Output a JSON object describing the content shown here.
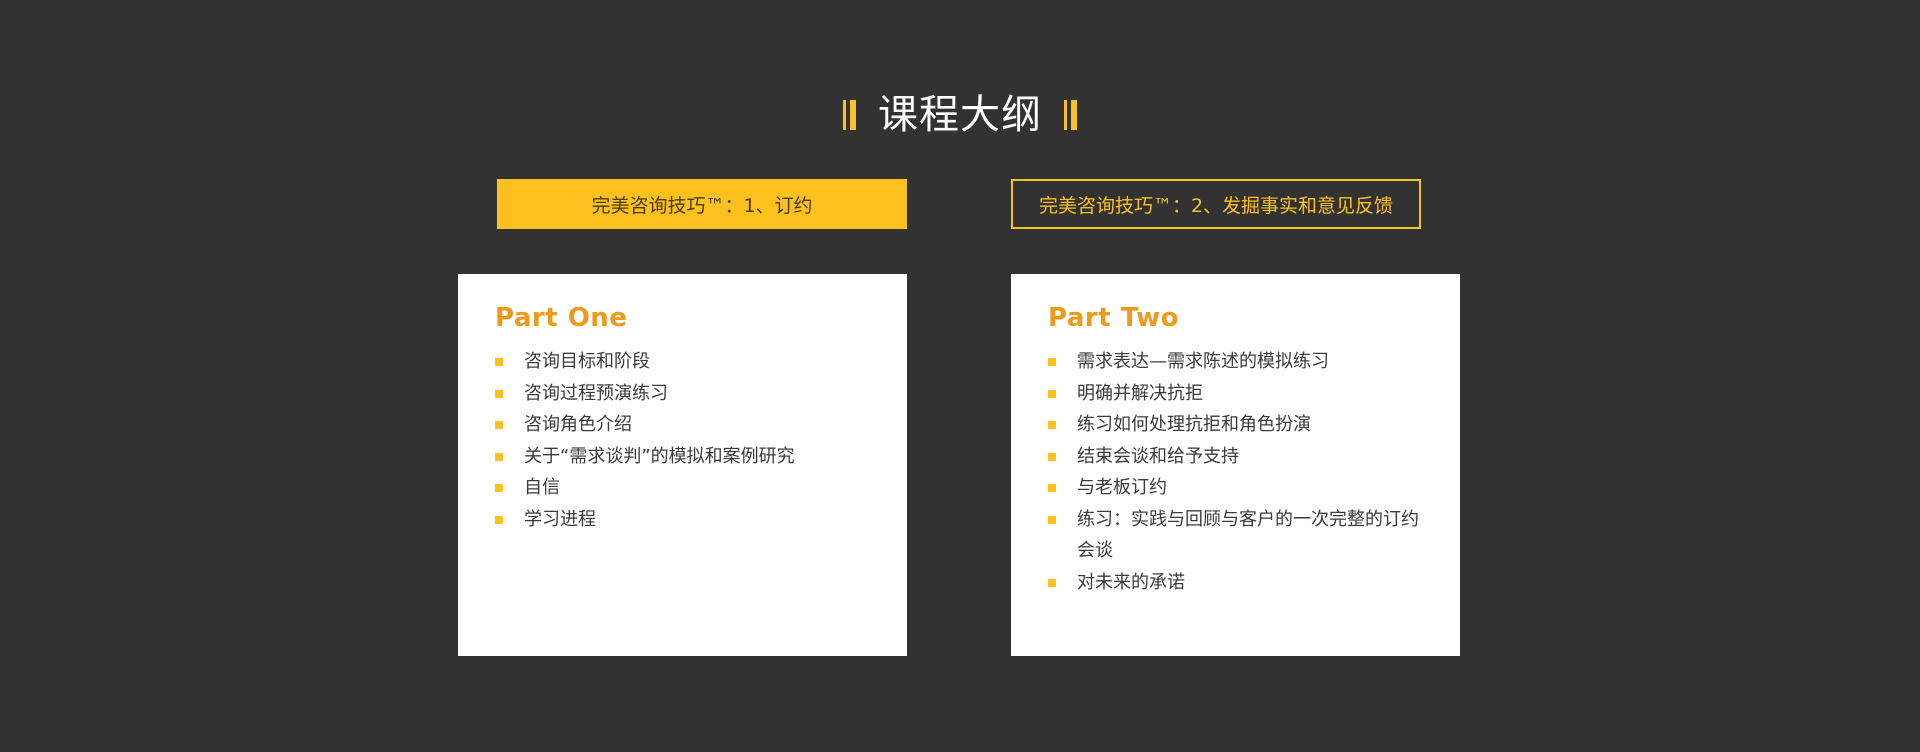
{
  "header": {
    "title": "课程大纲"
  },
  "tabs": [
    {
      "label": "完美咨询技巧™：1、订约",
      "active": true
    },
    {
      "label": "完美咨询技巧™：2、发掘事实和意见反馈",
      "active": false
    }
  ],
  "cards": [
    {
      "title": "Part One",
      "items": [
        "咨询目标和阶段",
        "咨询过程预演练习",
        "咨询角色介绍",
        "关于“需求谈判”的模拟和案例研究",
        "自信",
        "学习进程"
      ]
    },
    {
      "title": "Part Two",
      "items": [
        "需求表达—需求陈述的模拟练习",
        "明确并解决抗拒",
        "练习如何处理抗拒和角色扮演",
        "结束会谈和给予支持",
        "与老板订约",
        "练习：实践与回顾与客户的一次完整的订约会谈",
        "对未来的承诺"
      ]
    }
  ],
  "colors": {
    "background": "#323232",
    "accent": "#fcc11e",
    "part_title": "#ef9a1a",
    "card": "#ffffff",
    "text": "#3b3b3b"
  },
  "icons": {
    "title_decoration": "double-bar-icon",
    "list_bullet": "square-bullet-icon"
  }
}
